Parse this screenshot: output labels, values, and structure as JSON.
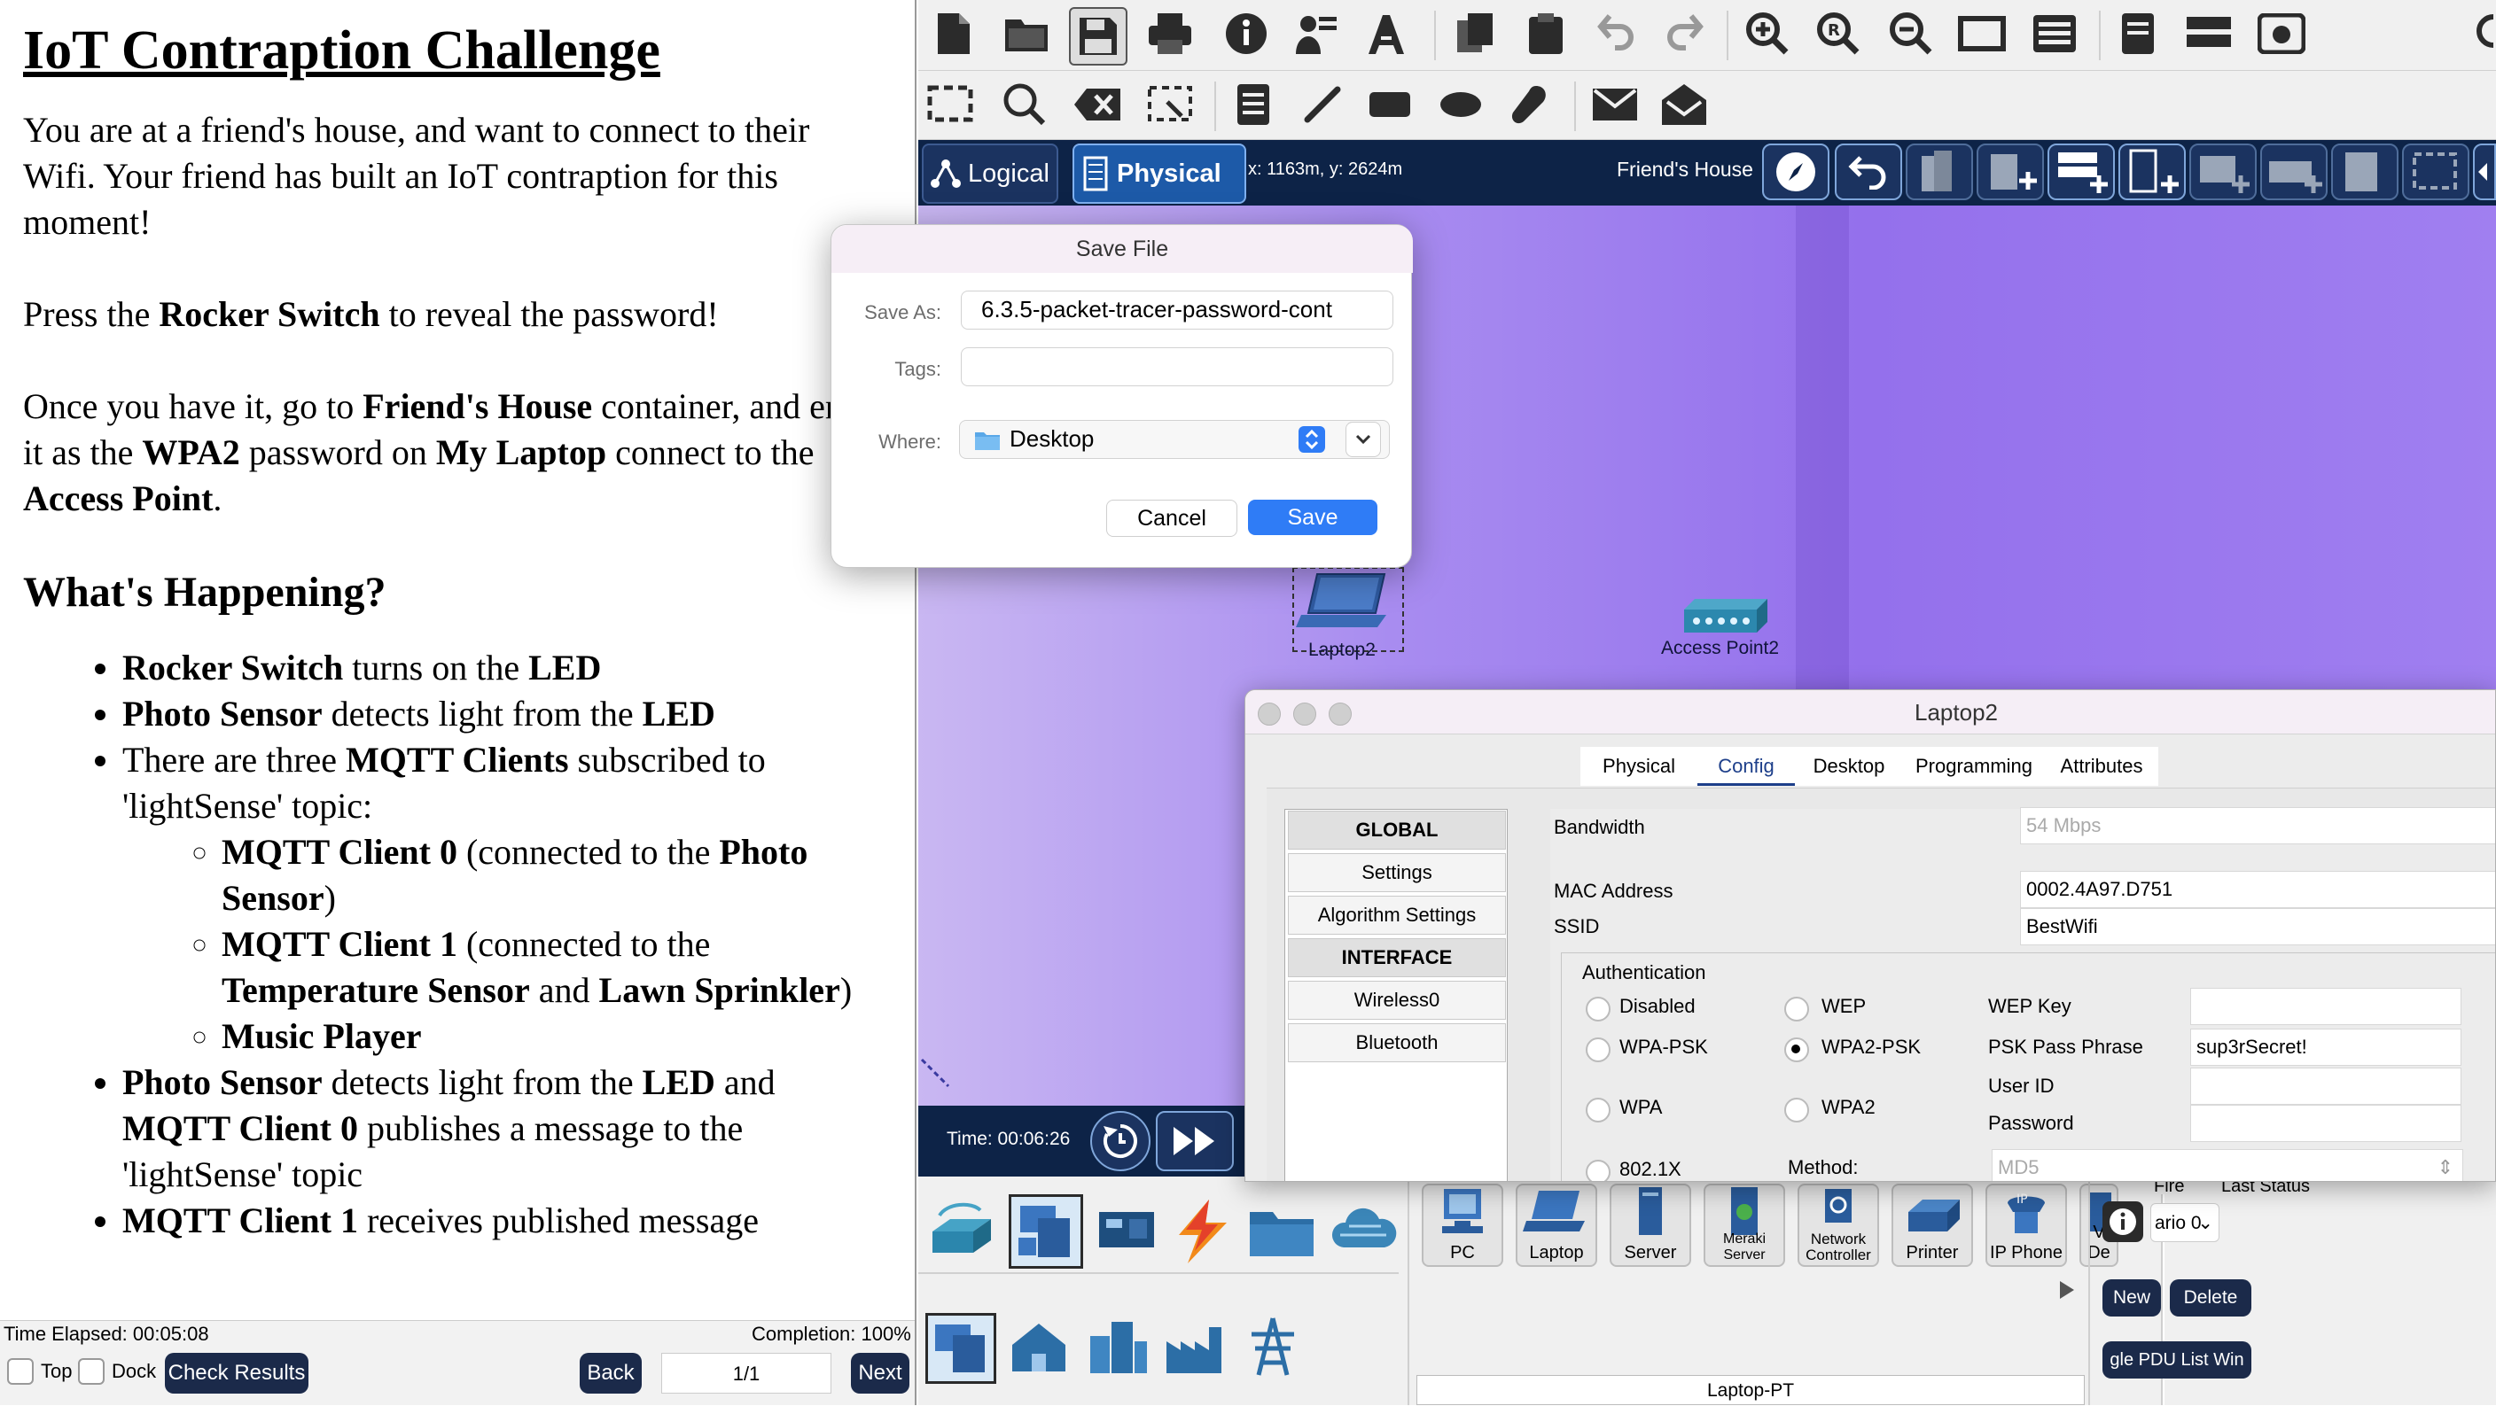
{
  "instructions": {
    "title": "IoT Contraption Challenge",
    "intro": "You are at a friend's house, and want to connect to their Wifi. Your friend has built an IoT contraption for this moment!",
    "press_pre": "Press the ",
    "press_bold": "Rocker Switch",
    "press_post": " to reveal the password!",
    "once_1": "Once you have it, go to ",
    "once_2": "Friend's House",
    "once_3": " container, and enter it as the ",
    "once_4": "WPA2",
    "once_5": " password on ",
    "once_6": "My Laptop",
    " connect_note": "",
    "once_7": " connect to the ",
    "once_8": "Access Point",
    "once_9": ".",
    "whats_happening": "What's Happening?",
    "b1_bold": "Rocker Switch",
    "b1_mid": " turns on the ",
    "b1_bold2": "LED",
    "b2_bold": "Photo Sensor",
    "b2_mid": " detects light from the ",
    "b2_bold2": "LED",
    "b3_pre": "There are three ",
    "b3_bold": "MQTT Clients",
    "b3_post": " subscribed to 'lightSense' topic:",
    "s1_bold": "MQTT Client 0",
    "s1_mid": " (connected to the ",
    "s1_bold2": "Photo Sensor",
    "s1_post": ")",
    "s2_bold": "MQTT Client 1",
    "s2_mid": " (connected to the ",
    "s2_bold2": "Temperature Sensor",
    "s2_and": " and ",
    "s2_bold3": "Lawn Sprinkler",
    "s2_post": ")",
    "s3_bold": "Music Player",
    "b4_bold": "Photo Sensor",
    "b4_mid": " detects light from the ",
    "b4_bold2": "LED",
    "b4_and": " and ",
    "b4_bold3": "MQTT Client 0",
    "b4_post": " publishes a message to the 'lightSense' topic",
    "b5_bold": "MQTT Client 1",
    "b5_post": " receives published message"
  },
  "left_footer": {
    "time_elapsed": "Time Elapsed: 00:05:08",
    "completion": "Completion: 100%",
    "top_label": "Top",
    "dock_label": "Dock",
    "check_results": "Check Results",
    "back": "Back",
    "page": "1/1",
    "next": "Next"
  },
  "navbar": {
    "logical": "Logical",
    "physical": "Physical",
    "coords": "x: 1163m, y: 2624m",
    "location": "Friend's House"
  },
  "workspace": {
    "laptop_label": "Laptop2",
    "ap_label": "Access Point2"
  },
  "timebar": {
    "time": "Time: 00:06:26"
  },
  "save_dialog": {
    "title": "Save File",
    "save_as_label": "Save As:",
    "save_as_value": "6.3.5-packet-tracer-password-cont",
    "tags_label": "Tags:",
    "tags_value": "",
    "where_label": "Where:",
    "where_value": "Desktop",
    "cancel": "Cancel",
    "save": "Save"
  },
  "laptop_window": {
    "title": "Laptop2",
    "tabs": [
      "Physical",
      "Config",
      "Desktop",
      "Programming",
      "Attributes"
    ],
    "active_tab": "Config",
    "sidebar": [
      "GLOBAL",
      "Settings",
      "Algorithm Settings",
      "INTERFACE",
      "Wireless0",
      "Bluetooth"
    ],
    "bandwidth_label": "Bandwidth",
    "bandwidth_value": "54 Mbps",
    "mac_label": "MAC Address",
    "mac_value": "0002.4A97.D751",
    "ssid_label": "SSID",
    "ssid_value": "BestWifi",
    "auth_label": "Authentication",
    "radios": [
      "Disabled",
      "WEP",
      "WPA-PSK",
      "WPA2-PSK",
      "WPA",
      "WPA2",
      "802.1X"
    ],
    "selected_auth": "WPA2-PSK",
    "wep_key_label": "WEP Key",
    "psk_label": "PSK Pass Phrase",
    "psk_value": "sup3rSecret!",
    "user_id_label": "User ID",
    "password_label": "Password",
    "method_label": "Method:",
    "method_value": "MD5"
  },
  "bottom_panel": {
    "devices": [
      "PC",
      "Laptop",
      "Server",
      "Meraki Server",
      "Network Controller",
      "Printer",
      "IP Phone",
      "V De"
    ],
    "fire_label": "Fire",
    "last_status_label": "Last Status",
    "scenario_label": "ario 0",
    "new_button": "New",
    "delete_button": "Delete",
    "pdu_button": "gle PDU List Win",
    "status_model": "Laptop-PT"
  },
  "colors": {
    "accent_blue": "#2f7cf6",
    "navy": "#0d2347",
    "workspace_purple": "#9470ec"
  }
}
